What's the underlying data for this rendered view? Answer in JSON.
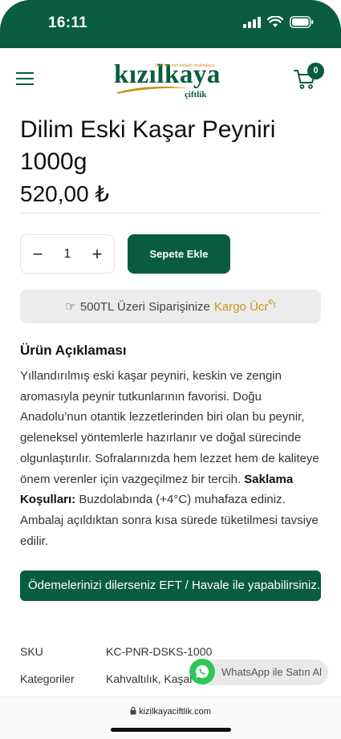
{
  "status": {
    "time": "16:11"
  },
  "header": {
    "logo_text": "kızılkaya",
    "logo_sub": "çiftlik",
    "logo_tagline": "1920'den beri doğalın tarafındayız",
    "cart_count": "0"
  },
  "product": {
    "title": "Dilim Eski Kaşar Peyniri 1000g",
    "price": "520,00 ₺",
    "quantity": "1",
    "qty_minus": "−",
    "qty_plus": "+",
    "add_to_cart": "Sepete Ekle"
  },
  "shipping_note": {
    "icon": "☞",
    "text": "500TL Üzeri Siparişinize",
    "highlight": "Kargo Ücr",
    "highlight_up": "e",
    "highlight_tail": "t"
  },
  "description": {
    "title": "Ürün Açıklaması",
    "body": "Yıllandırılmış eski kaşar peyniri, keskin ve zengin aromasıyla peynir tutkunlarının favorisi. Doğu Anadolu’nun otantik lezzetlerinden biri olan bu peynir, geleneksel yöntemlerle hazırlanır ve doğal sürecinde olgunlaştırılır. Sofralarınızda hem lezzet hem de kaliteye önem verenler için vazgeçilmez bir tercih.",
    "storage_label": "Saklama Koşulları:",
    "storage_text": " Buzdolabında (+4°C) muhafaza ediniz. Ambalaj açıldıktan sonra kısa sürede tüketilmesi tavsiye edilir."
  },
  "payment_banner": "Ödemelerinizi dilerseniz EFT / Havale ile yapabilirsiniz.",
  "meta": {
    "sku_label": "SKU",
    "sku_value": "KC-PNR-DSKS-1000",
    "categories_label": "Kategoriler",
    "categories_value": "Kahvaltılık, Kaşar"
  },
  "whatsapp": {
    "label": "WhatsApp ile Satın Al"
  },
  "browser": {
    "url": "kizilkayaciftlik.com"
  },
  "colors": {
    "brand_green": "#0a5c3f",
    "accent_gold": "#c8951e",
    "whatsapp_green": "#2ec55a"
  }
}
